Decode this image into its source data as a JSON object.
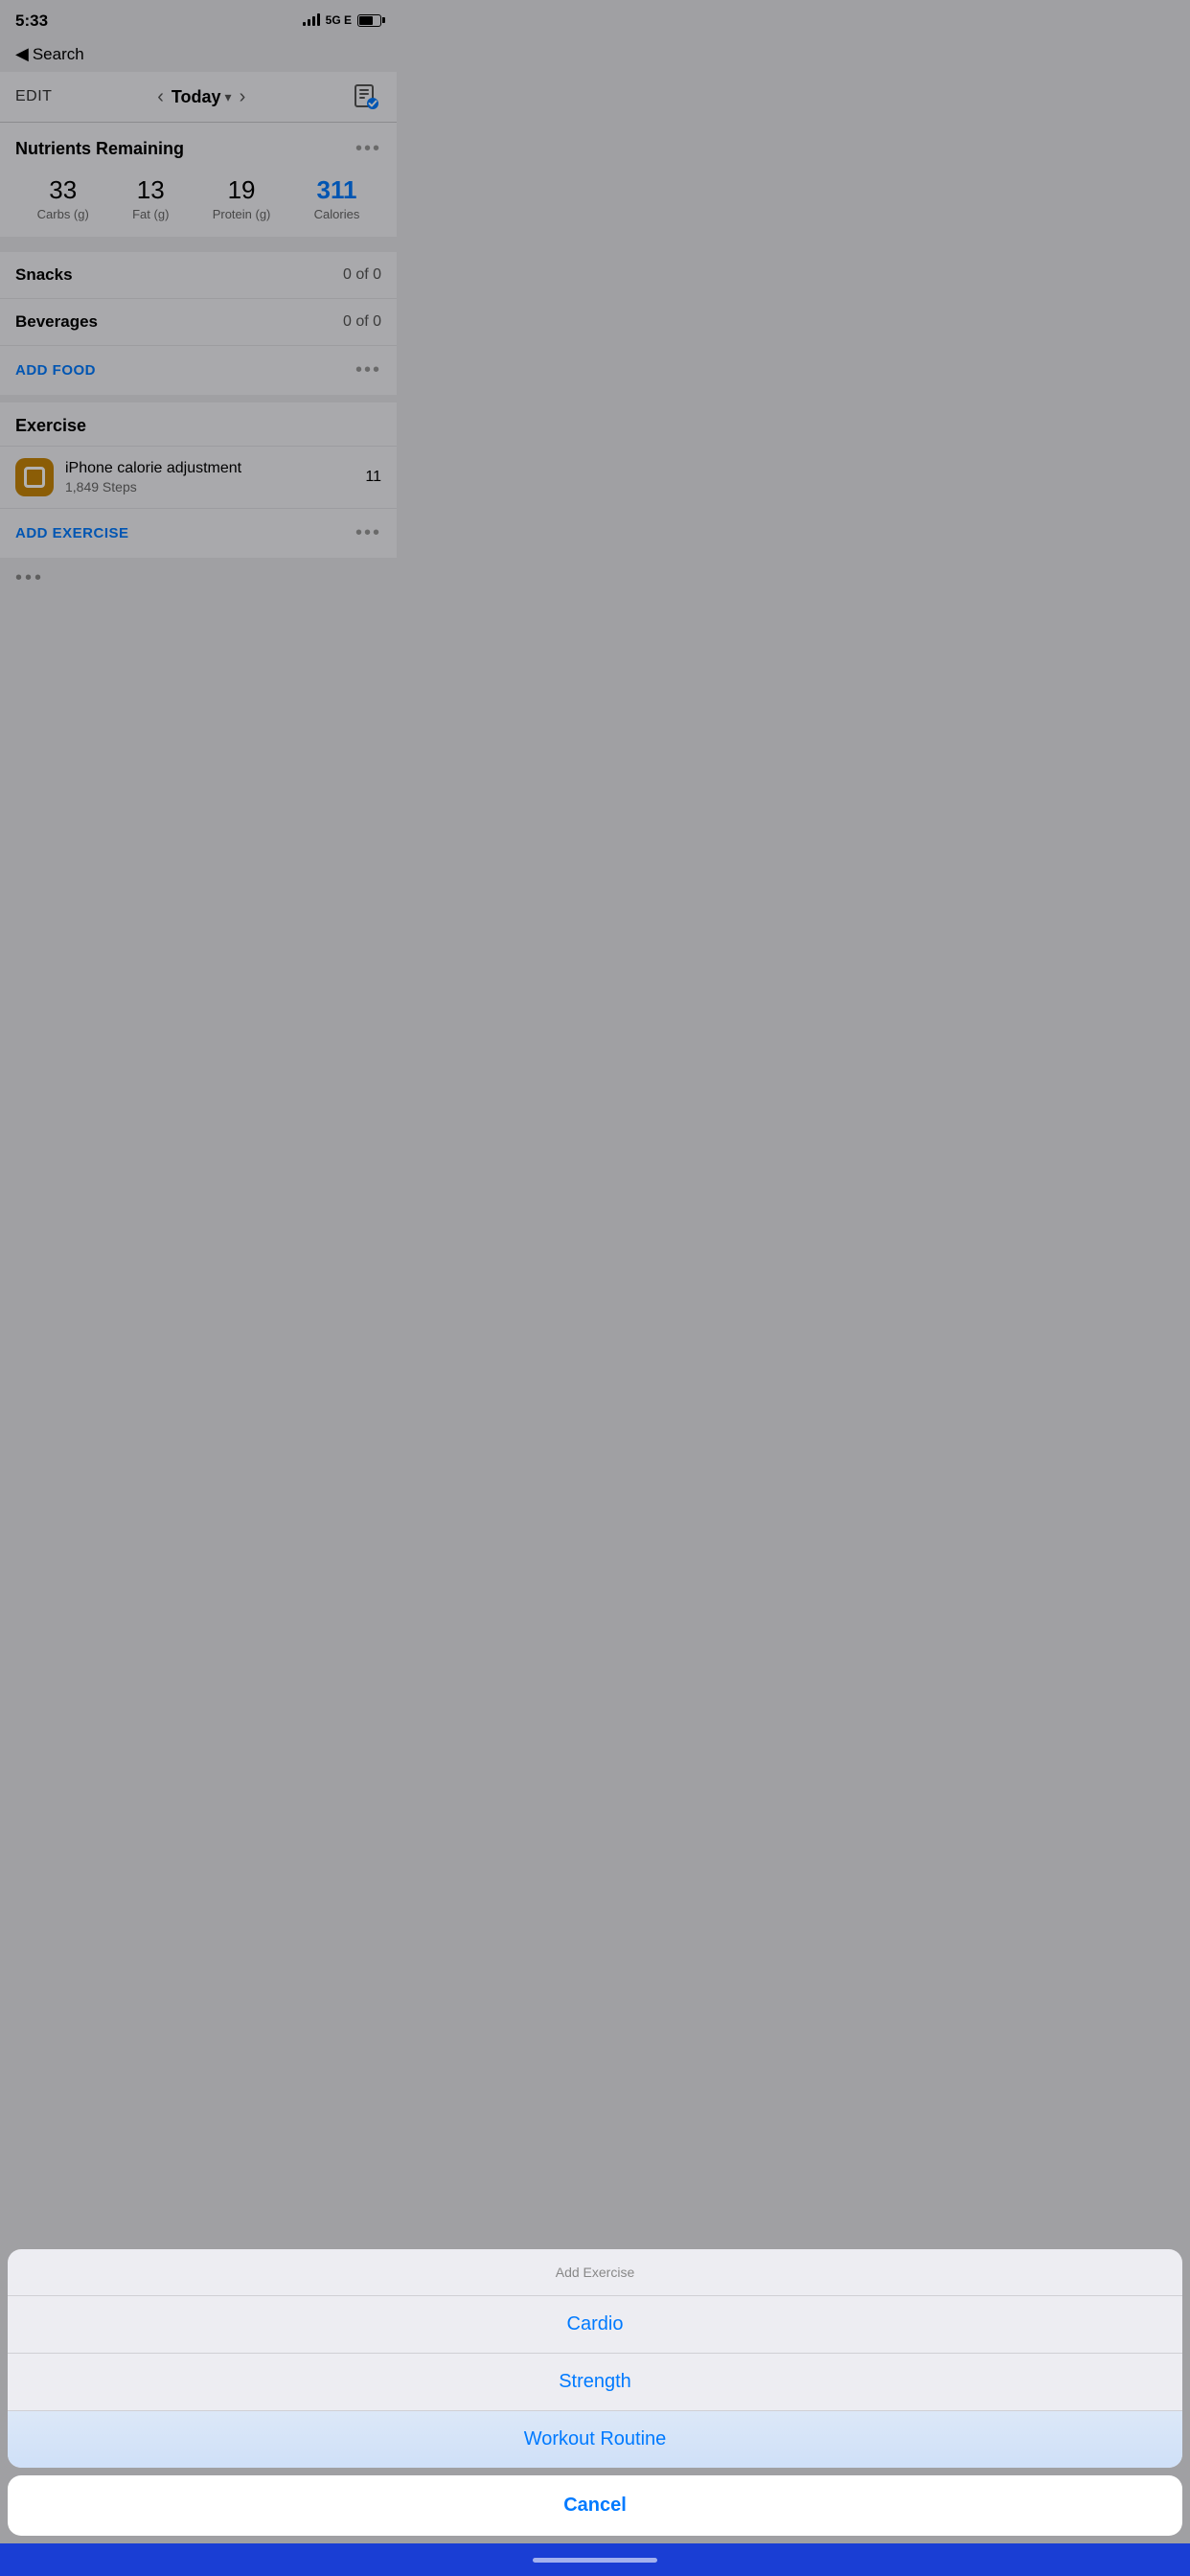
{
  "statusBar": {
    "time": "5:33",
    "network": "5G E",
    "batteryPercent": 65
  },
  "navigation": {
    "backLabel": "Search",
    "editLabel": "EDIT",
    "todayLabel": "Today",
    "diaryIconLabel": "diary-check-icon"
  },
  "nutrients": {
    "title": "Nutrients Remaining",
    "moreLabel": "•••",
    "items": [
      {
        "value": "33",
        "label": "Carbs (g)",
        "isBlue": false
      },
      {
        "value": "13",
        "label": "Fat (g)",
        "isBlue": false
      },
      {
        "value": "19",
        "label": "Protein (g)",
        "isBlue": false
      },
      {
        "value": "311",
        "label": "Calories",
        "isBlue": true
      }
    ]
  },
  "foodSections": [
    {
      "label": "Snacks",
      "value": "0 of 0"
    },
    {
      "label": "Beverages",
      "value": "0 of 0"
    }
  ],
  "addFood": {
    "label": "ADD FOOD",
    "dotsLabel": "•••"
  },
  "exercise": {
    "title": "Exercise",
    "items": [
      {
        "name": "iPhone calorie adjustment",
        "sub": "1,849 Steps",
        "value": "11"
      }
    ]
  },
  "addExercise": {
    "label": "ADD EXERCISE",
    "dotsLabel": "•••"
  },
  "actionSheet": {
    "title": "Add Exercise",
    "items": [
      {
        "label": "Cardio"
      },
      {
        "label": "Strength"
      },
      {
        "label": "Workout Routine"
      }
    ],
    "cancelLabel": "Cancel"
  }
}
